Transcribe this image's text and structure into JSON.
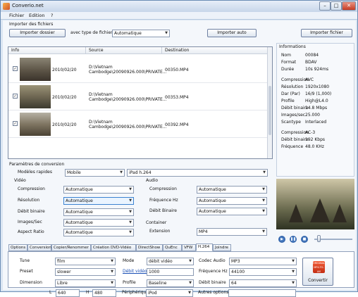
{
  "window": {
    "title": "Converio.net"
  },
  "menu": [
    "Fichier",
    "Edition",
    "?"
  ],
  "import": {
    "section_label": "Importer des fichiers",
    "folder_button": "Importer dossier",
    "type_label": "avec type de fichier",
    "type_value": "Automatique",
    "auto_button": "Importer auto",
    "file_button": "Importer fichier"
  },
  "files": {
    "columns": [
      "Info",
      "Source",
      "Destination"
    ],
    "rows": [
      {
        "checked": true,
        "date": "2010/02/20",
        "source": "D:\\Vietnam Cambodge\\20090926.000\\PRIVATE...",
        "destination": "00350.MP4"
      },
      {
        "checked": true,
        "date": "2010/02/20",
        "source": "D:\\Vietnam Cambodge\\20090926.000\\PRIVATE...",
        "destination": "00353.MP4"
      },
      {
        "checked": true,
        "date": "2010/02/20",
        "source": "D:\\Vietnam Cambodge\\20090926.000\\PRIVATE...",
        "destination": "00392.MP4"
      }
    ]
  },
  "info": {
    "title": "Informations",
    "rows": [
      {
        "k": "Nom",
        "v": "00084"
      },
      {
        "k": "Format",
        "v": "BDAV"
      },
      {
        "k": "Durée",
        "v": "10s 924ms"
      },
      {
        "k": "",
        "v": ""
      },
      {
        "k": "Compression",
        "v": "AVC"
      },
      {
        "k": "Résolution",
        "v": "1920x1080"
      },
      {
        "k": "Dar (Par)",
        "v": "16/9 (1,000)"
      },
      {
        "k": "Profile",
        "v": "High@L4.0"
      },
      {
        "k": "Débit binaire",
        "v": "14.8 Mbps"
      },
      {
        "k": "Images/sec",
        "v": "25.000"
      },
      {
        "k": "Scantype",
        "v": "Interlaced"
      },
      {
        "k": "",
        "v": ""
      },
      {
        "k": "Compression",
        "v": "AC-3"
      },
      {
        "k": "Débit binaire",
        "v": "192 Kbps"
      },
      {
        "k": "Fréquence",
        "v": "48.0 KHz"
      }
    ]
  },
  "params": {
    "section_label": "Paramètres de conversion",
    "models_label": "Modèles rapides",
    "model_value": "Mobile",
    "preset_value": "iPad h.264",
    "video": {
      "title": "Vidéo",
      "fields": [
        {
          "label": "Compression",
          "value": "Automatique"
        },
        {
          "label": "Résolution",
          "value": "Automatique"
        },
        {
          "label": "Débit binaire",
          "value": "Automatique"
        },
        {
          "label": "Images/Sec",
          "value": "Automatique"
        },
        {
          "label": "Aspect Ratio",
          "value": "Automatique"
        }
      ]
    },
    "audio": {
      "title": "Audio",
      "fields": [
        {
          "label": "Compression",
          "value": "Automatique"
        },
        {
          "label": "Fréquence Hz",
          "value": "Automatique"
        },
        {
          "label": "Débit Binaire",
          "value": "Automatique"
        }
      ]
    },
    "container": {
      "title": "Container",
      "label": "Extension",
      "value": "MP4"
    }
  },
  "tabs": [
    "Options",
    "Conversion",
    "Copier/Renommer",
    "Création DVD-Vidéo",
    "DirectShow",
    "QuEnc",
    "VFW",
    "H.264",
    "Joindre"
  ],
  "active_tab": 7,
  "h264": {
    "tune_label": "Tune",
    "tune_value": "film",
    "preset_label": "Preset",
    "preset_value": "slower",
    "dimension_label": "Dimension",
    "dimension_value": "Libre",
    "l_label": "L",
    "l_value": "640",
    "h_label": "H",
    "h_value": "480",
    "mode_label": "Mode",
    "mode_value": "débit vidéo",
    "bitrate_label": "Débit vidéo",
    "bitrate_value": "1000",
    "profile_label": "Profile",
    "profile_value": "Baseline",
    "device_label": "Périphérique",
    "device_value": "iPod",
    "audio_codec_label": "Codec Audio",
    "audio_codec_value": "MP3",
    "freq_label": "Fréquence Hz",
    "freq_value": "44100",
    "abitrate_label": "Débit binaire",
    "abitrate_value": "64",
    "other_label": "Autres options",
    "other_value": ""
  },
  "convert": {
    "label": "Convertir",
    "icon_caption": "ORIGINAL MP4-TO-AVI"
  }
}
